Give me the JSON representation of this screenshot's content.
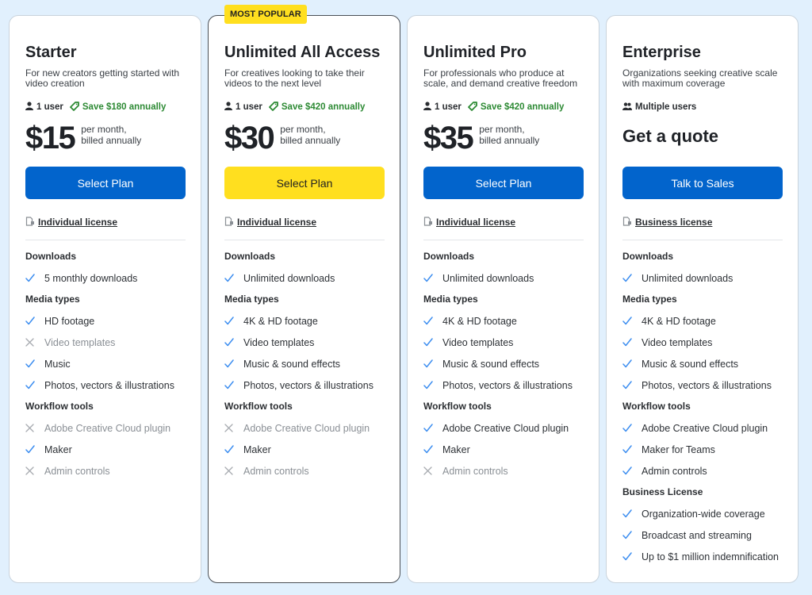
{
  "colors": {
    "background": "#e1f0fd",
    "primary_button": "#0264cc",
    "highlight": "#ffdf1f",
    "save_green": "#2d8a34",
    "check_blue": "#3d8ef0",
    "cross_gray": "#a7abb0"
  },
  "plans": [
    {
      "title": "Starter",
      "description": "For new creators getting started with video creation",
      "users": "1 user",
      "users_icon": "user-icon",
      "savings": "Save $180 annually",
      "price": "$15",
      "price_note_line1": "per month,",
      "price_note_line2": "billed annually",
      "button_label": "Select Plan",
      "button_style": "blue",
      "license": "Individual license",
      "sections": [
        {
          "heading": "Downloads",
          "features": [
            {
              "label": "5 monthly downloads",
              "included": true
            }
          ]
        },
        {
          "heading": "Media types",
          "features": [
            {
              "label": "HD footage",
              "included": true
            },
            {
              "label": "Video templates",
              "included": false
            },
            {
              "label": "Music",
              "included": true
            },
            {
              "label": "Photos, vectors & illustrations",
              "included": true
            }
          ]
        },
        {
          "heading": "Workflow tools",
          "features": [
            {
              "label": "Adobe Creative Cloud plugin",
              "included": false
            },
            {
              "label": "Maker",
              "included": true
            },
            {
              "label": "Admin controls",
              "included": false
            }
          ]
        }
      ]
    },
    {
      "badge": "MOST POPULAR",
      "title": "Unlimited All Access",
      "description": "For creatives looking to take their videos to the next level",
      "users": "1 user",
      "users_icon": "user-icon",
      "savings": "Save $420 annually",
      "price": "$30",
      "price_note_line1": "per month,",
      "price_note_line2": "billed annually",
      "button_label": "Select Plan",
      "button_style": "yellow",
      "license": "Individual license",
      "sections": [
        {
          "heading": "Downloads",
          "features": [
            {
              "label": "Unlimited downloads",
              "included": true
            }
          ]
        },
        {
          "heading": "Media types",
          "features": [
            {
              "label": "4K & HD footage",
              "included": true
            },
            {
              "label": "Video templates",
              "included": true
            },
            {
              "label": "Music & sound effects",
              "included": true
            },
            {
              "label": "Photos, vectors & illustrations",
              "included": true
            }
          ]
        },
        {
          "heading": "Workflow tools",
          "features": [
            {
              "label": "Adobe Creative Cloud plugin",
              "included": false
            },
            {
              "label": "Maker",
              "included": true
            },
            {
              "label": "Admin controls",
              "included": false
            }
          ]
        }
      ]
    },
    {
      "title": "Unlimited Pro",
      "description": "For professionals who produce at scale, and demand creative freedom",
      "users": "1 user",
      "users_icon": "user-icon",
      "savings": "Save $420 annually",
      "price": "$35",
      "price_note_line1": "per month,",
      "price_note_line2": "billed annually",
      "button_label": "Select Plan",
      "button_style": "blue",
      "license": "Individual license",
      "sections": [
        {
          "heading": "Downloads",
          "features": [
            {
              "label": "Unlimited downloads",
              "included": true
            }
          ]
        },
        {
          "heading": "Media types",
          "features": [
            {
              "label": "4K & HD footage",
              "included": true
            },
            {
              "label": "Video templates",
              "included": true
            },
            {
              "label": "Music & sound effects",
              "included": true
            },
            {
              "label": "Photos, vectors & illustrations",
              "included": true
            }
          ]
        },
        {
          "heading": "Workflow tools",
          "features": [
            {
              "label": "Adobe Creative Cloud plugin",
              "included": true
            },
            {
              "label": "Maker",
              "included": true
            },
            {
              "label": "Admin controls",
              "included": false
            }
          ]
        }
      ]
    },
    {
      "title": "Enterprise",
      "description": "Organizations seeking creative scale with maximum coverage",
      "users": "Multiple users",
      "users_icon": "users-icon",
      "quote": "Get a quote",
      "button_label": "Talk to Sales",
      "button_style": "blue",
      "license": "Business license",
      "sections": [
        {
          "heading": "Downloads",
          "features": [
            {
              "label": "Unlimited downloads",
              "included": true
            }
          ]
        },
        {
          "heading": "Media types",
          "features": [
            {
              "label": "4K & HD footage",
              "included": true
            },
            {
              "label": "Video templates",
              "included": true
            },
            {
              "label": "Music & sound effects",
              "included": true
            },
            {
              "label": "Photos, vectors & illustrations",
              "included": true
            }
          ]
        },
        {
          "heading": "Workflow tools",
          "features": [
            {
              "label": "Adobe Creative Cloud plugin",
              "included": true
            },
            {
              "label": "Maker for Teams",
              "included": true
            },
            {
              "label": "Admin controls",
              "included": true
            }
          ]
        },
        {
          "heading": "Business License",
          "features": [
            {
              "label": "Organization-wide coverage",
              "included": true
            },
            {
              "label": "Broadcast and streaming",
              "included": true
            },
            {
              "label": "Up to $1 million indemnification",
              "included": true
            }
          ]
        }
      ]
    }
  ]
}
